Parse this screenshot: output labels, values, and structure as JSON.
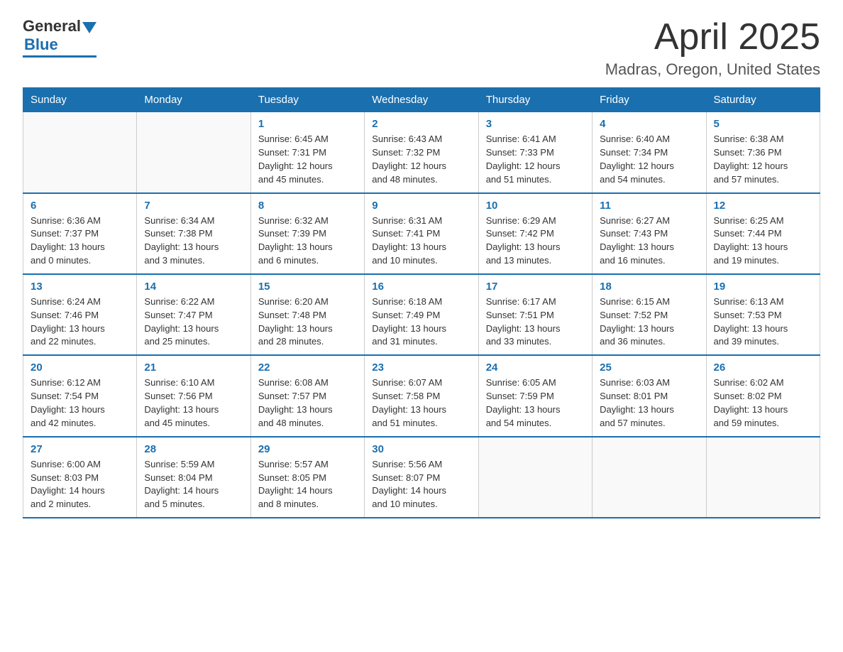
{
  "header": {
    "logo_general": "General",
    "logo_blue": "Blue",
    "month": "April 2025",
    "location": "Madras, Oregon, United States"
  },
  "weekdays": [
    "Sunday",
    "Monday",
    "Tuesday",
    "Wednesday",
    "Thursday",
    "Friday",
    "Saturday"
  ],
  "weeks": [
    [
      {
        "day": "",
        "info": ""
      },
      {
        "day": "",
        "info": ""
      },
      {
        "day": "1",
        "info": "Sunrise: 6:45 AM\nSunset: 7:31 PM\nDaylight: 12 hours\nand 45 minutes."
      },
      {
        "day": "2",
        "info": "Sunrise: 6:43 AM\nSunset: 7:32 PM\nDaylight: 12 hours\nand 48 minutes."
      },
      {
        "day": "3",
        "info": "Sunrise: 6:41 AM\nSunset: 7:33 PM\nDaylight: 12 hours\nand 51 minutes."
      },
      {
        "day": "4",
        "info": "Sunrise: 6:40 AM\nSunset: 7:34 PM\nDaylight: 12 hours\nand 54 minutes."
      },
      {
        "day": "5",
        "info": "Sunrise: 6:38 AM\nSunset: 7:36 PM\nDaylight: 12 hours\nand 57 minutes."
      }
    ],
    [
      {
        "day": "6",
        "info": "Sunrise: 6:36 AM\nSunset: 7:37 PM\nDaylight: 13 hours\nand 0 minutes."
      },
      {
        "day": "7",
        "info": "Sunrise: 6:34 AM\nSunset: 7:38 PM\nDaylight: 13 hours\nand 3 minutes."
      },
      {
        "day": "8",
        "info": "Sunrise: 6:32 AM\nSunset: 7:39 PM\nDaylight: 13 hours\nand 6 minutes."
      },
      {
        "day": "9",
        "info": "Sunrise: 6:31 AM\nSunset: 7:41 PM\nDaylight: 13 hours\nand 10 minutes."
      },
      {
        "day": "10",
        "info": "Sunrise: 6:29 AM\nSunset: 7:42 PM\nDaylight: 13 hours\nand 13 minutes."
      },
      {
        "day": "11",
        "info": "Sunrise: 6:27 AM\nSunset: 7:43 PM\nDaylight: 13 hours\nand 16 minutes."
      },
      {
        "day": "12",
        "info": "Sunrise: 6:25 AM\nSunset: 7:44 PM\nDaylight: 13 hours\nand 19 minutes."
      }
    ],
    [
      {
        "day": "13",
        "info": "Sunrise: 6:24 AM\nSunset: 7:46 PM\nDaylight: 13 hours\nand 22 minutes."
      },
      {
        "day": "14",
        "info": "Sunrise: 6:22 AM\nSunset: 7:47 PM\nDaylight: 13 hours\nand 25 minutes."
      },
      {
        "day": "15",
        "info": "Sunrise: 6:20 AM\nSunset: 7:48 PM\nDaylight: 13 hours\nand 28 minutes."
      },
      {
        "day": "16",
        "info": "Sunrise: 6:18 AM\nSunset: 7:49 PM\nDaylight: 13 hours\nand 31 minutes."
      },
      {
        "day": "17",
        "info": "Sunrise: 6:17 AM\nSunset: 7:51 PM\nDaylight: 13 hours\nand 33 minutes."
      },
      {
        "day": "18",
        "info": "Sunrise: 6:15 AM\nSunset: 7:52 PM\nDaylight: 13 hours\nand 36 minutes."
      },
      {
        "day": "19",
        "info": "Sunrise: 6:13 AM\nSunset: 7:53 PM\nDaylight: 13 hours\nand 39 minutes."
      }
    ],
    [
      {
        "day": "20",
        "info": "Sunrise: 6:12 AM\nSunset: 7:54 PM\nDaylight: 13 hours\nand 42 minutes."
      },
      {
        "day": "21",
        "info": "Sunrise: 6:10 AM\nSunset: 7:56 PM\nDaylight: 13 hours\nand 45 minutes."
      },
      {
        "day": "22",
        "info": "Sunrise: 6:08 AM\nSunset: 7:57 PM\nDaylight: 13 hours\nand 48 minutes."
      },
      {
        "day": "23",
        "info": "Sunrise: 6:07 AM\nSunset: 7:58 PM\nDaylight: 13 hours\nand 51 minutes."
      },
      {
        "day": "24",
        "info": "Sunrise: 6:05 AM\nSunset: 7:59 PM\nDaylight: 13 hours\nand 54 minutes."
      },
      {
        "day": "25",
        "info": "Sunrise: 6:03 AM\nSunset: 8:01 PM\nDaylight: 13 hours\nand 57 minutes."
      },
      {
        "day": "26",
        "info": "Sunrise: 6:02 AM\nSunset: 8:02 PM\nDaylight: 13 hours\nand 59 minutes."
      }
    ],
    [
      {
        "day": "27",
        "info": "Sunrise: 6:00 AM\nSunset: 8:03 PM\nDaylight: 14 hours\nand 2 minutes."
      },
      {
        "day": "28",
        "info": "Sunrise: 5:59 AM\nSunset: 8:04 PM\nDaylight: 14 hours\nand 5 minutes."
      },
      {
        "day": "29",
        "info": "Sunrise: 5:57 AM\nSunset: 8:05 PM\nDaylight: 14 hours\nand 8 minutes."
      },
      {
        "day": "30",
        "info": "Sunrise: 5:56 AM\nSunset: 8:07 PM\nDaylight: 14 hours\nand 10 minutes."
      },
      {
        "day": "",
        "info": ""
      },
      {
        "day": "",
        "info": ""
      },
      {
        "day": "",
        "info": ""
      }
    ]
  ]
}
